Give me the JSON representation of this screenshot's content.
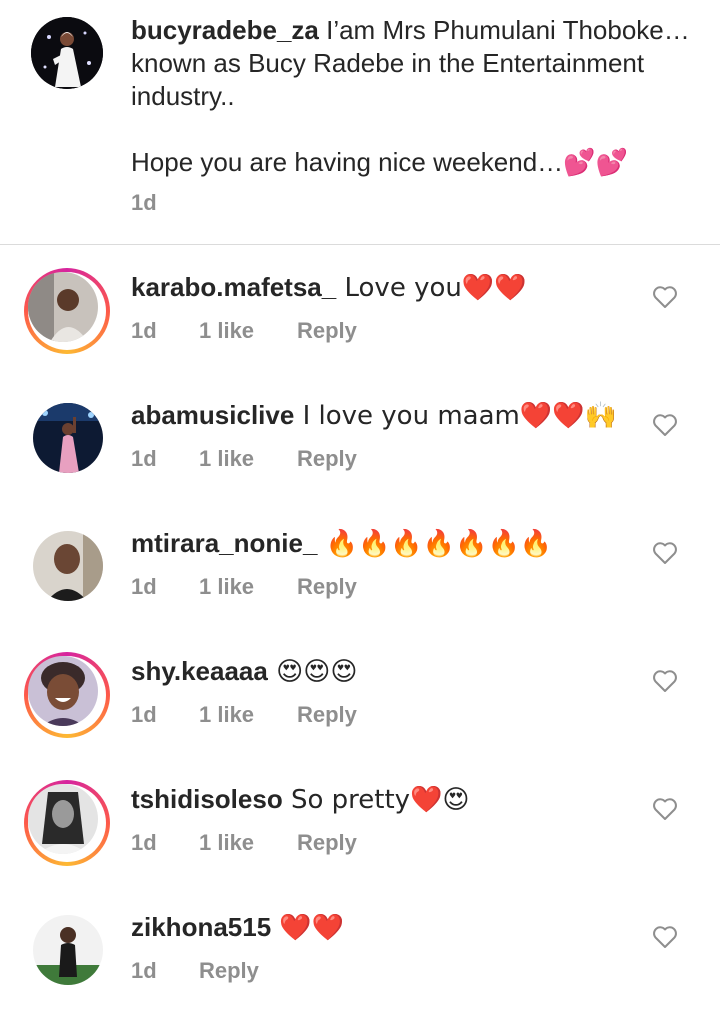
{
  "caption": {
    "username": "bucyradebe_za",
    "text": " I’am Mrs Phumulani Thoboke… known as Bucy Radebe in the Entertainment industry..\n\nHope you are having nice weekend…💕💕",
    "time": "1d"
  },
  "comments": [
    {
      "username": "karabo.mafetsa_",
      "text": " Love you❤️❤️",
      "time": "1d",
      "likes": "1 like",
      "reply": "Reply",
      "story_ring": true
    },
    {
      "username": "abamusiclive",
      "text": " I love you maam❤️❤️🙌",
      "time": "1d",
      "likes": "1 like",
      "reply": "Reply",
      "story_ring": false
    },
    {
      "username": "mtirara_nonie_",
      "text": " 🔥🔥🔥🔥🔥🔥🔥",
      "time": "1d",
      "likes": "1 like",
      "reply": "Reply",
      "story_ring": false
    },
    {
      "username": "shy.keaaaa",
      "text": " 😍😍😍",
      "time": "1d",
      "likes": "1 like",
      "reply": "Reply",
      "story_ring": true
    },
    {
      "username": "tshidisoleso",
      "text": " So pretty❤️😍",
      "time": "1d",
      "likes": "1 like",
      "reply": "Reply",
      "story_ring": true
    },
    {
      "username": "zikhona515",
      "text": " ❤️❤️",
      "time": "1d",
      "likes": "",
      "reply": "Reply",
      "story_ring": false
    }
  ],
  "icons": {
    "like": "heart-outline-icon"
  },
  "colors": {
    "text": "#262626",
    "secondary": "#8e8e8e",
    "divider": "#dbdbdb"
  }
}
